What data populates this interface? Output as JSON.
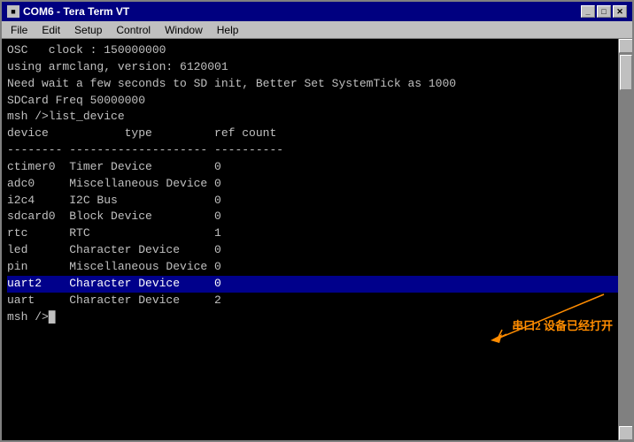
{
  "window": {
    "title": "COM6 - Tera Term VT",
    "title_icon": "■"
  },
  "title_buttons": {
    "minimize": "_",
    "maximize": "□",
    "close": "✕"
  },
  "menu": {
    "items": [
      "File",
      "Edit",
      "Setup",
      "Control",
      "Window",
      "Help"
    ]
  },
  "terminal": {
    "lines": [
      {
        "text": "OSC   clock : 150000000",
        "type": "normal"
      },
      {
        "text": "",
        "type": "normal"
      },
      {
        "text": "using armclang, version: 6120001",
        "type": "normal"
      },
      {
        "text": "",
        "type": "normal"
      },
      {
        "text": "Need wait a few seconds to SD init, Better Set SystemTick as 1000",
        "type": "normal"
      },
      {
        "text": "",
        "type": "normal"
      },
      {
        "text": "SDCard Freq 50000000",
        "type": "normal"
      },
      {
        "text": "",
        "type": "normal"
      },
      {
        "text": "msh />list_device",
        "type": "normal"
      },
      {
        "text": "device           type         ref count",
        "type": "normal"
      },
      {
        "text": "-------- -------------------- ----------",
        "type": "normal"
      },
      {
        "text": "ctimer0  Timer Device         0",
        "type": "normal"
      },
      {
        "text": "adc0     Miscellaneous Device 0",
        "type": "normal"
      },
      {
        "text": "i2c4     I2C Bus              0",
        "type": "normal"
      },
      {
        "text": "sdcard0  Block Device         0",
        "type": "normal"
      },
      {
        "text": "rtc      RTC                  1",
        "type": "normal"
      },
      {
        "text": "led      Character Device     0",
        "type": "normal"
      },
      {
        "text": "pin      Miscellaneous Device 0",
        "type": "normal"
      },
      {
        "text": "uart2    Character Device     0",
        "type": "highlight"
      },
      {
        "text": "uart     Character Device     2",
        "type": "normal"
      },
      {
        "text": "msh />█",
        "type": "normal"
      }
    ]
  },
  "annotation": {
    "text": "串口2 设备已经打开",
    "arrow": "→"
  },
  "scrollbar": {
    "up_arrow": "▲",
    "down_arrow": "▼"
  }
}
